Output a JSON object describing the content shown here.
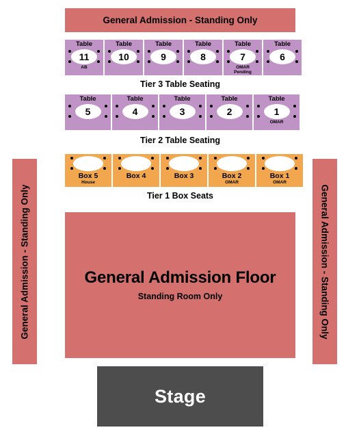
{
  "colors": {
    "general_admission": "#d4706e",
    "table_section": "#bf93c6",
    "box_section": "#f2a74e",
    "stage": "#4d4d4d",
    "seat_dot": "#000000",
    "table_surface": "#ffffff"
  },
  "general_admission": {
    "top_banner_label": "General Admission - Standing Only",
    "left_banner_label": "General Admission - Standing Only",
    "right_banner_label": "General Admission - Standing Only",
    "floor_title": "General Admission Floor",
    "floor_subtitle": "Standing Room Only"
  },
  "tier3": {
    "caption": "Tier 3 Table Seating",
    "word": "Table",
    "seats_per_table": 4,
    "tables": [
      {
        "number": "11",
        "sub": "AB"
      },
      {
        "number": "10",
        "sub": ""
      },
      {
        "number": "9",
        "sub": ""
      },
      {
        "number": "8",
        "sub": ""
      },
      {
        "number": "7",
        "sub": "OMAR\nPending"
      },
      {
        "number": "6",
        "sub": ""
      }
    ]
  },
  "tier2": {
    "caption": "Tier 2 Table Seating",
    "word": "Table",
    "seats_per_table": 4,
    "tables": [
      {
        "number": "5",
        "sub": ""
      },
      {
        "number": "4",
        "sub": ""
      },
      {
        "number": "3",
        "sub": ""
      },
      {
        "number": "2",
        "sub": ""
      },
      {
        "number": "1",
        "sub": "OMAR"
      }
    ]
  },
  "tier1": {
    "caption": "Tier 1 Box Seats",
    "seats_per_box": 4,
    "boxes": [
      {
        "label": "Box 5",
        "sub": "House"
      },
      {
        "label": "Box 4",
        "sub": ""
      },
      {
        "label": "Box 3",
        "sub": ""
      },
      {
        "label": "Box 2",
        "sub": "OMAR"
      },
      {
        "label": "Box 1",
        "sub": "OMAR"
      }
    ]
  },
  "stage": {
    "label": "Stage"
  }
}
